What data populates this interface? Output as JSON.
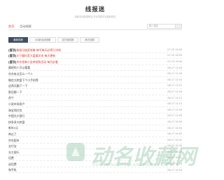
{
  "site": {
    "title": "线报迷",
    "tagline": "最新活动线报网站,羊毛党薅羊毛福利网站"
  },
  "nav": {
    "items": [
      {
        "label": "首页",
        "active": true
      },
      {
        "label": "活动线报",
        "active": false
      }
    ],
    "search_placeholder": "输入搜索"
  },
  "tabs": [
    {
      "label": "最新线报",
      "active": true
    },
    {
      "label": "QQ新活动线报",
      "active": false
    },
    {
      "label": "支付宝线报",
      "active": false
    },
    {
      "label": "其它线报",
      "active": false
    }
  ],
  "list": [
    {
      "tag": "[置顶]",
      "title": "摇摇乐抽奖攻略 每号每天必得几块钱",
      "date": "07-15 19:00",
      "pinned": true
    },
    {
      "tag": "[置顶]",
      "title": "大只猫抖音大盘薅羊毛 每天更新",
      "date": "07-15 19:00",
      "pinned": true
    },
    {
      "tag": "[置顶]",
      "title": "京东领券小金库抢购活动 每月必看",
      "date": "07-15 19:00",
      "pinned": true
    },
    {
      "tag": "",
      "title": "薅吧的人可以看看",
      "date": "06-17 11:45",
      "pinned": false
    },
    {
      "tag": "",
      "title": "京东有点怎么一个人",
      "date": "06-17 11:34",
      "pinned": false
    },
    {
      "tag": "",
      "title": "微信大转盘下个小手机等",
      "date": "06-17 11:32",
      "pinned": false
    },
    {
      "tag": "",
      "title": "这两天翻了一下",
      "date": "06-17 11:21",
      "pinned": false
    },
    {
      "tag": "",
      "title": "那还都一下",
      "date": "06-17 11:16",
      "pinned": false
    },
    {
      "tag": "",
      "title": "苏宁",
      "date": "06-17 11:15",
      "pinned": false
    },
    {
      "tag": "",
      "title": "小说市场用户",
      "date": "06-17 11:13",
      "pinned": false
    },
    {
      "tag": "",
      "title": "淘宝领红包",
      "date": "06-17 11:09",
      "pinned": false
    },
    {
      "tag": "",
      "title": "中国光大银行",
      "date": "06-17 11:05",
      "pinned": false
    },
    {
      "tag": "",
      "title": "拼多多大转盘",
      "date": "06-17 10:55",
      "pinned": false
    },
    {
      "tag": "",
      "title": "新年5元",
      "date": "06-17 10:54",
      "pinned": false
    },
    {
      "tag": "",
      "title": "带过了",
      "date": "06-17 10:52",
      "pinned": false
    },
    {
      "tag": "",
      "title": "京东超市",
      "date": "06-17 10:41",
      "pinned": false
    },
    {
      "tag": "",
      "title": "支付宝",
      "date": "06-17 10:34",
      "pinned": false
    },
    {
      "tag": "",
      "title": "光大银行",
      "date": "06-17 10:29",
      "pinned": false
    },
    {
      "tag": "",
      "title": "话费",
      "date": "06-17 10:21",
      "pinned": false
    },
    {
      "tag": "",
      "title": "送话费",
      "date": "06-17 10:19",
      "pinned": false
    },
    {
      "tag": "",
      "title": "和手机",
      "date": "06-17 10:16",
      "pinned": false
    }
  ],
  "watermark": {
    "text": "动名收藏网",
    "sub": "DONGMINGSHOUCANGWANG.COM"
  },
  "colors": {
    "accent": "#e03b32",
    "tab_active": "#3f4f5f",
    "watermark": "#96c8aa"
  }
}
